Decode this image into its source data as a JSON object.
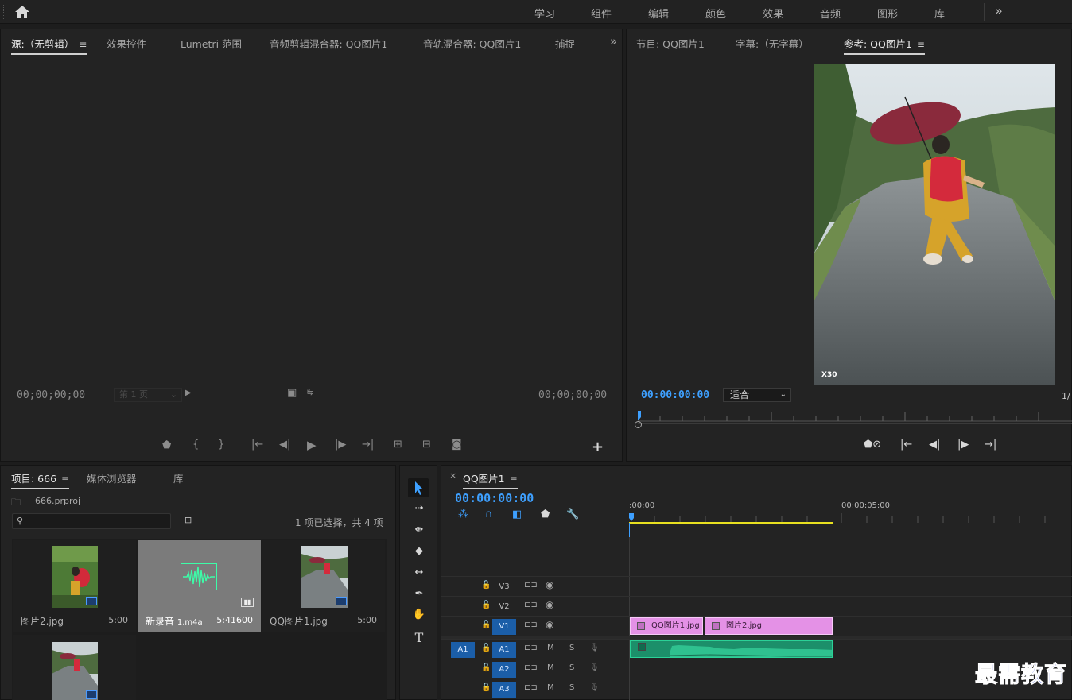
{
  "workspaces": [
    "学习",
    "组件",
    "编辑",
    "颜色",
    "效果",
    "音频",
    "图形",
    "库"
  ],
  "source_panel": {
    "tabs": [
      "源:（无剪辑）",
      "效果控件",
      "Lumetri 范围",
      "音频剪辑混合器: QQ图片1",
      "音轨混合器: QQ图片1",
      "捕捉"
    ],
    "timecode_left": "00;00;00;00",
    "timecode_right": "00;00;00;00",
    "page_select": "第 1 页"
  },
  "program_panel": {
    "tabs": [
      "节目: QQ图片1",
      "字幕:（无字幕）",
      "参考: QQ图片1"
    ],
    "timecode": "00:00:00:00",
    "fit": "适合",
    "scale": "1/",
    "watermark_text": "X30"
  },
  "project_panel": {
    "tabs": [
      "项目: 666",
      "媒体浏览器",
      "库"
    ],
    "project_file": "666.prproj",
    "selection_status": "1 项已选择，共 4 项",
    "items": [
      {
        "name": "图片2.jpg",
        "duration": "5:00"
      },
      {
        "name": "新录音",
        "ext": "1.m4a",
        "duration": "5:41600"
      },
      {
        "name": "QQ图片1.jpg",
        "duration": "5:00"
      },
      {
        "name": "",
        "duration": ""
      }
    ]
  },
  "timeline": {
    "title": "QQ图片1",
    "timecode": "00:00:00:00",
    "ruler": [
      ":00:00",
      "00:00:05:00"
    ],
    "video_tracks": [
      "V3",
      "V2",
      "V1"
    ],
    "audio_tracks": [
      "A1",
      "A2",
      "A3"
    ],
    "source_patch": "A1",
    "track_m": "M",
    "track_s": "S",
    "clips": [
      "QQ图片1.jpg",
      "图片2.jpg"
    ]
  },
  "watermark": "最需教育",
  "colors": {
    "accent": "#3ea0ff",
    "track_on": "#1b5ea8",
    "video_clip": "#e491e6",
    "audio_clip": "#1fa77a",
    "work_area": "#e8e020"
  }
}
